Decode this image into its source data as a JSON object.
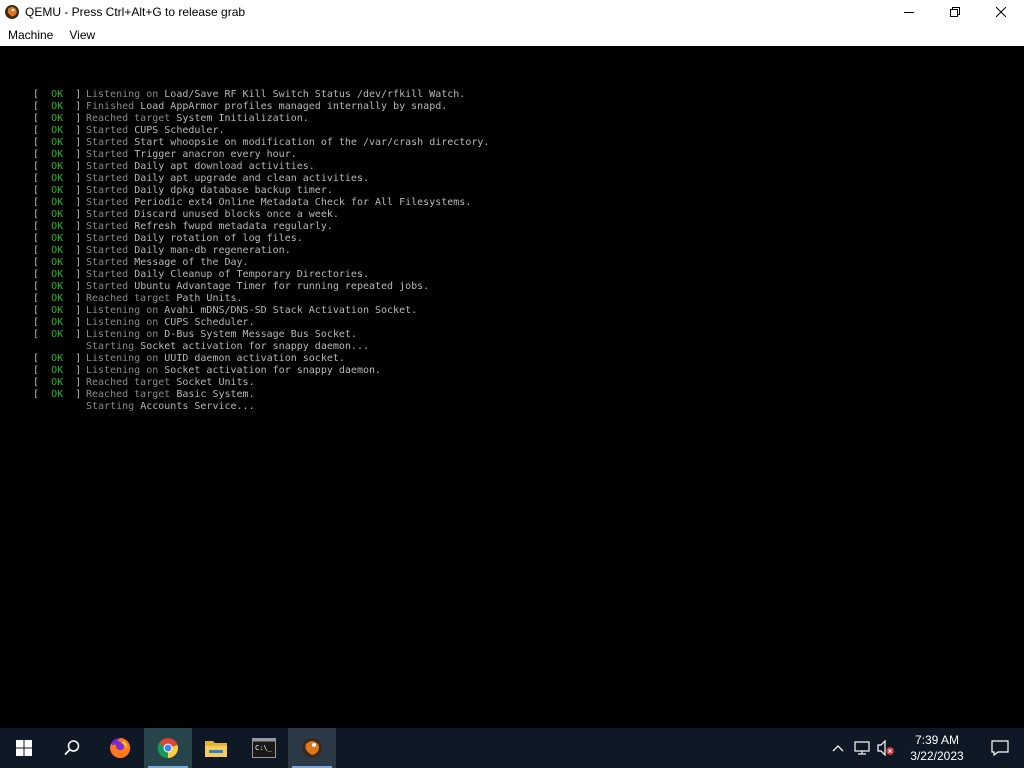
{
  "window": {
    "title": "QEMU - Press Ctrl+Alt+G to release grab",
    "app_icon": "qemu-icon",
    "controls": [
      "minimize-icon",
      "restore-icon",
      "close-icon"
    ]
  },
  "menu": {
    "items": [
      {
        "label": "Machine"
      },
      {
        "label": "View"
      }
    ]
  },
  "console": {
    "lines": [
      {
        "ok": true,
        "verb": "Listening on",
        "rest": "Load/Save RF Kill Switch Status /dev/rfkill Watch."
      },
      {
        "ok": true,
        "verb": "Finished",
        "rest": "Load AppArmor profiles managed internally by snapd."
      },
      {
        "ok": true,
        "verb": "Reached target",
        "rest": "System Initialization."
      },
      {
        "ok": true,
        "verb": "Started",
        "rest": "CUPS Scheduler."
      },
      {
        "ok": true,
        "verb": "Started",
        "rest": "Start whoopsie on modification of the /var/crash directory."
      },
      {
        "ok": true,
        "verb": "Started",
        "rest": "Trigger anacron every hour."
      },
      {
        "ok": true,
        "verb": "Started",
        "rest": "Daily apt download activities."
      },
      {
        "ok": true,
        "verb": "Started",
        "rest": "Daily apt upgrade and clean activities."
      },
      {
        "ok": true,
        "verb": "Started",
        "rest": "Daily dpkg database backup timer."
      },
      {
        "ok": true,
        "verb": "Started",
        "rest": "Periodic ext4 Online Metadata Check for All Filesystems."
      },
      {
        "ok": true,
        "verb": "Started",
        "rest": "Discard unused blocks once a week."
      },
      {
        "ok": true,
        "verb": "Started",
        "rest": "Refresh fwupd metadata regularly."
      },
      {
        "ok": true,
        "verb": "Started",
        "rest": "Daily rotation of log files."
      },
      {
        "ok": true,
        "verb": "Started",
        "rest": "Daily man-db regeneration."
      },
      {
        "ok": true,
        "verb": "Started",
        "rest": "Message of the Day."
      },
      {
        "ok": true,
        "verb": "Started",
        "rest": "Daily Cleanup of Temporary Directories."
      },
      {
        "ok": true,
        "verb": "Started",
        "rest": "Ubuntu Advantage Timer for running repeated jobs."
      },
      {
        "ok": true,
        "verb": "Reached target",
        "rest": "Path Units."
      },
      {
        "ok": true,
        "verb": "Listening on",
        "rest": "Avahi mDNS/DNS-SD Stack Activation Socket."
      },
      {
        "ok": true,
        "verb": "Listening on",
        "rest": "CUPS Scheduler."
      },
      {
        "ok": true,
        "verb": "Listening on",
        "rest": "D-Bus System Message Bus Socket."
      },
      {
        "ok": false,
        "verb": "Starting",
        "rest": "Socket activation for snappy daemon..."
      },
      {
        "ok": true,
        "verb": "Listening on",
        "rest": "UUID daemon activation socket."
      },
      {
        "ok": true,
        "verb": "Listening on",
        "rest": "Socket activation for snappy daemon."
      },
      {
        "ok": true,
        "verb": "Reached target",
        "rest": "Socket Units."
      },
      {
        "ok": true,
        "verb": "Reached target",
        "rest": "Basic System."
      },
      {
        "ok": false,
        "verb": "Starting",
        "rest": "Accounts Service..."
      }
    ],
    "ok_text": "OK",
    "colors": {
      "background": "#000000",
      "ok": "#2fb32f",
      "text": "#b8b8b8",
      "verb": "#8a8a8a"
    }
  },
  "taskbar": {
    "apps": [
      {
        "icon": "windows-start-icon"
      },
      {
        "icon": "search-icon"
      },
      {
        "icon": "firefox-icon"
      },
      {
        "icon": "chrome-icon"
      },
      {
        "icon": "file-explorer-icon"
      },
      {
        "icon": "terminal-icon"
      },
      {
        "icon": "qemu-icon"
      }
    ],
    "tray": {
      "icons": [
        "chevron-up-icon",
        "network-icon",
        "volume-muted-icon"
      ],
      "time": "7:39 AM",
      "date": "3/22/2023",
      "notification_icon": "notification-icon"
    }
  }
}
